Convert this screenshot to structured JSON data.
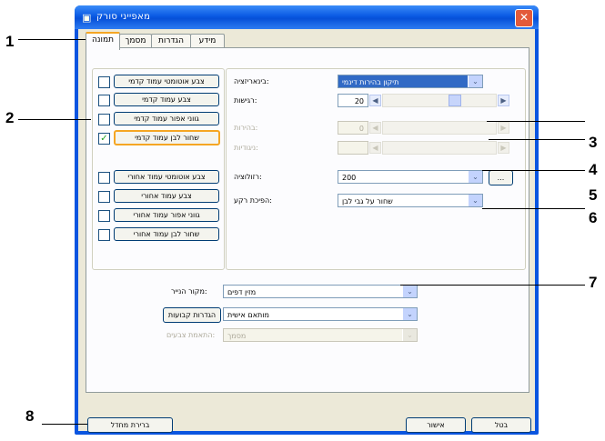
{
  "window": {
    "title": "מאפייני סורק"
  },
  "tabs": [
    "תמונה",
    "מסמך",
    "הגדרות",
    "מידע"
  ],
  "front_presets": [
    {
      "label": "צבע אוטומטי עמוד קדמי",
      "checked": false
    },
    {
      "label": "צבע עמוד קדמי",
      "checked": false
    },
    {
      "label": "גווני אפור עמוד קדמי",
      "checked": false
    },
    {
      "label": "שחור לבן עמוד קדמי",
      "checked": true
    }
  ],
  "rear_presets": [
    {
      "label": "צבע אוטומטי עמוד אחורי",
      "checked": false
    },
    {
      "label": "צבע עמוד אחורי",
      "checked": false
    },
    {
      "label": "גווני אפור עמוד אחורי",
      "checked": false
    },
    {
      "label": "שחור לבן עמוד אחורי",
      "checked": false
    }
  ],
  "settings": {
    "binarization_label": "בינאריזציה:",
    "binarization_value": "תיקון בהירות דינמי",
    "sensitivity_label": "רגישות:",
    "sensitivity_value": "20",
    "brightness_label": "בהירות:",
    "brightness_value": "0",
    "contrast_label": "ניגודיות:",
    "contrast_value": "",
    "resolution_label": "רזולוציה:",
    "resolution_value": "200",
    "resolution_more": "...",
    "invert_label": "הפיכת רקע:",
    "invert_value": "שחור על גבי לבן"
  },
  "paper": {
    "source_label": "מקור הנייר:",
    "source_value": "מזין דפים",
    "custom_button": "הגדרות קבועות",
    "custom_value": "מותאם אישית",
    "color_match_label": "התאמת צבעים:",
    "color_match_value": "מסמך"
  },
  "footer": {
    "defaults_button": "ברירת מחדל",
    "ok_button": "אישור",
    "cancel_button": "בטל"
  },
  "callouts": [
    "1",
    "2",
    "3",
    "4",
    "5",
    "6",
    "7",
    "8"
  ]
}
